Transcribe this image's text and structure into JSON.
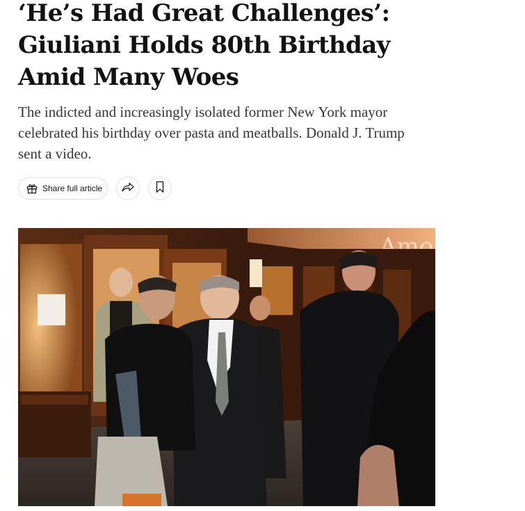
{
  "article": {
    "headline": "‘He’s Had Great Challenges’: Giuliani Holds 80th Birthday Amid Many Woes",
    "summary": "The indicted and increasingly isolated former New York mayor celebrated his birthday over pasta and meatballs. Donald J. Trump sent a video."
  },
  "toolbar": {
    "share_full_label": "Share full article",
    "share_full_icon": "gift-icon",
    "share_icon": "share-arrow-icon",
    "save_icon": "bookmark-icon"
  },
  "photo": {
    "sign_text": "Amo"
  }
}
